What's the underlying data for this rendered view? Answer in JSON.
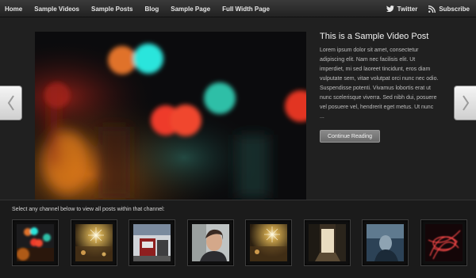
{
  "nav": {
    "items": [
      "Home",
      "Sample Videos",
      "Sample Posts",
      "Blog",
      "Sample Page",
      "Full Width Page"
    ]
  },
  "social": {
    "twitter": "Twitter",
    "subscribe": "Subscribe"
  },
  "featured": {
    "title": "This is a Sample Video Post",
    "excerpt": "Lorem ipsum dolor sit amet, consectetur adipiscing elit. Nam nec facilisis elit. Ut imperdiet, mi sed laoreet tincidunt, eros diam vulputate sem, vitae volutpat orci nunc nec odio. Suspendisse potenti. Vivamus lobortis erat ut nunc scelerisque viverra. Sed nibh dui, posuere vel posuere vel, hendrerit eget metus. Ut nunc ...",
    "button": "Continue Reading"
  },
  "channels": {
    "label": "Select any channel below to view all posts within that channel:"
  }
}
